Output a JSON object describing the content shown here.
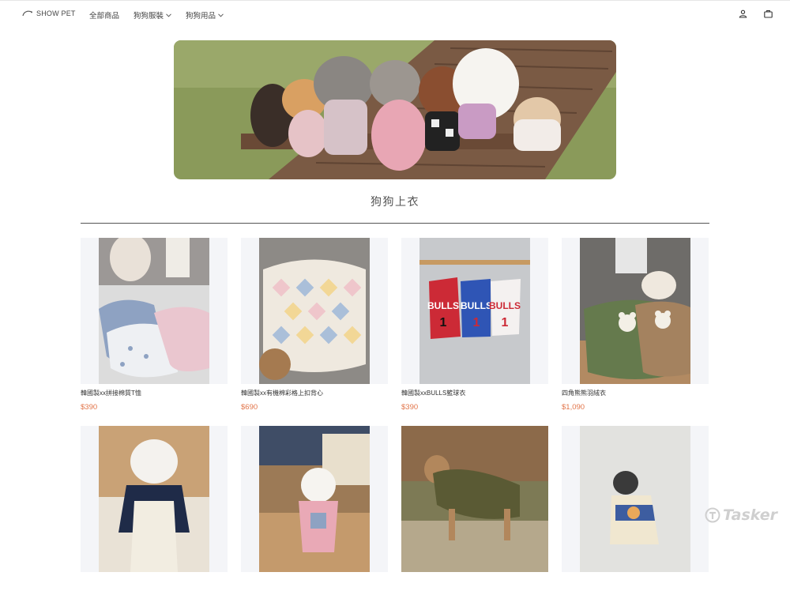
{
  "header": {
    "brand": "SHOW PET",
    "nav": [
      {
        "label": "全部商品",
        "dropdown": false
      },
      {
        "label": "狗狗服裝",
        "dropdown": true
      },
      {
        "label": "狗狗用品",
        "dropdown": true
      }
    ]
  },
  "section": {
    "title": "狗狗上衣"
  },
  "products": [
    {
      "name": "韓國製xx拼接棉質T恤",
      "price": "$390"
    },
    {
      "name": "韓國製xx有機棉彩格上扣背心",
      "price": "$690"
    },
    {
      "name": "韓國製xxBULLS籃球衣",
      "price": "$390"
    },
    {
      "name": "四角熊熊羽絨衣",
      "price": "$1,090"
    },
    {
      "name": "",
      "price": ""
    },
    {
      "name": "",
      "price": ""
    },
    {
      "name": "",
      "price": ""
    },
    {
      "name": "",
      "price": ""
    }
  ],
  "watermark": "Tasker",
  "colors": {
    "price": "#e2754a",
    "text": "#444444",
    "thumb_bg": "#f4f5f8"
  }
}
